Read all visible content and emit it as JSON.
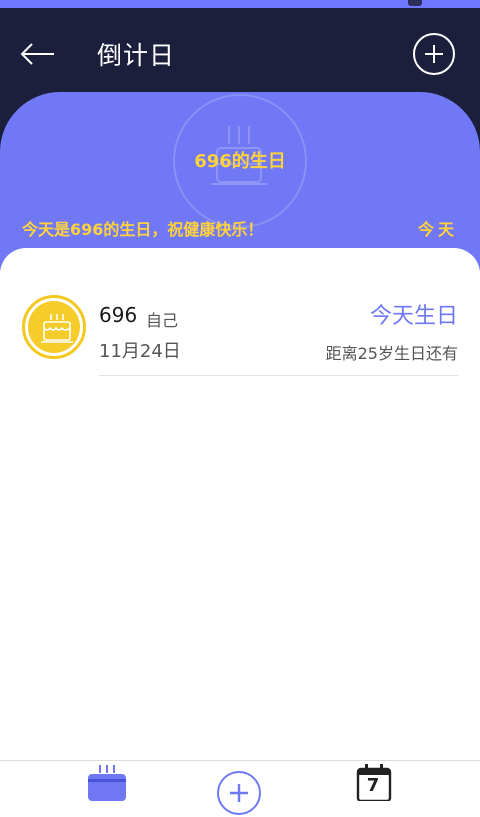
{
  "app": {
    "title": "倒计日"
  },
  "colors": {
    "primary": "#7078f5",
    "dark": "#1b1f3b",
    "accent": "#ffd23c",
    "avatar": "#f5cc2a"
  },
  "header": {
    "back_icon": "back-arrow-icon",
    "add_icon": "plus-circle-icon"
  },
  "hero": {
    "name": "696的生日",
    "message": "今天是696的生日，祝健康快乐！",
    "today_label": "今天",
    "icon": "cake-icon"
  },
  "list": [
    {
      "name": "696",
      "relation": "自己",
      "date": "11月24日",
      "status": "今天生日",
      "note": "距离25岁生日还有",
      "icon": "cake-icon"
    }
  ],
  "bottom_nav": {
    "birthday_icon": "cake-icon",
    "add_icon": "plus-circle-icon",
    "calendar_icon": "calendar-icon",
    "calendar_day": "7"
  }
}
